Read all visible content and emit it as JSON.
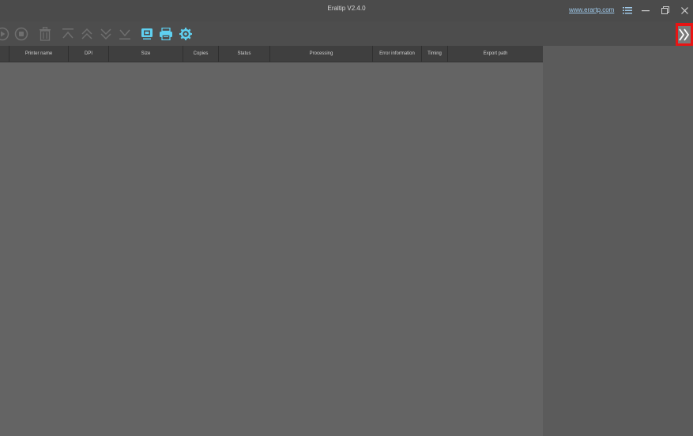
{
  "window": {
    "title": "Eraltip V2.4.0",
    "site_link": "www.erartp.com",
    "controls": [
      "menu-icon",
      "minimize-icon",
      "restore-icon",
      "close-icon"
    ]
  },
  "toolbar": {
    "buttons": [
      {
        "name": "start-icon",
        "enabled": false
      },
      {
        "name": "stop-icon",
        "enabled": false
      },
      {
        "name": "delete-icon",
        "enabled": false
      },
      {
        "name": "move-to-top-icon",
        "enabled": false
      },
      {
        "name": "move-up-icon",
        "enabled": false
      },
      {
        "name": "move-down-icon",
        "enabled": false
      },
      {
        "name": "move-to-bottom-icon",
        "enabled": false
      },
      {
        "name": "preview-icon",
        "enabled": true
      },
      {
        "name": "print-icon",
        "enabled": true
      },
      {
        "name": "printer-settings-icon",
        "enabled": true
      }
    ],
    "accent_color": "#5fd0f0"
  },
  "table": {
    "columns": [
      "Printer name",
      "DPI",
      "Size",
      "Copies",
      "Status",
      "Processing",
      "Error information",
      "Timing",
      "Export path"
    ],
    "rows": []
  },
  "panel": {
    "expand_icon": "double-chevron-right-icon",
    "highlight_color": "#e81414"
  }
}
